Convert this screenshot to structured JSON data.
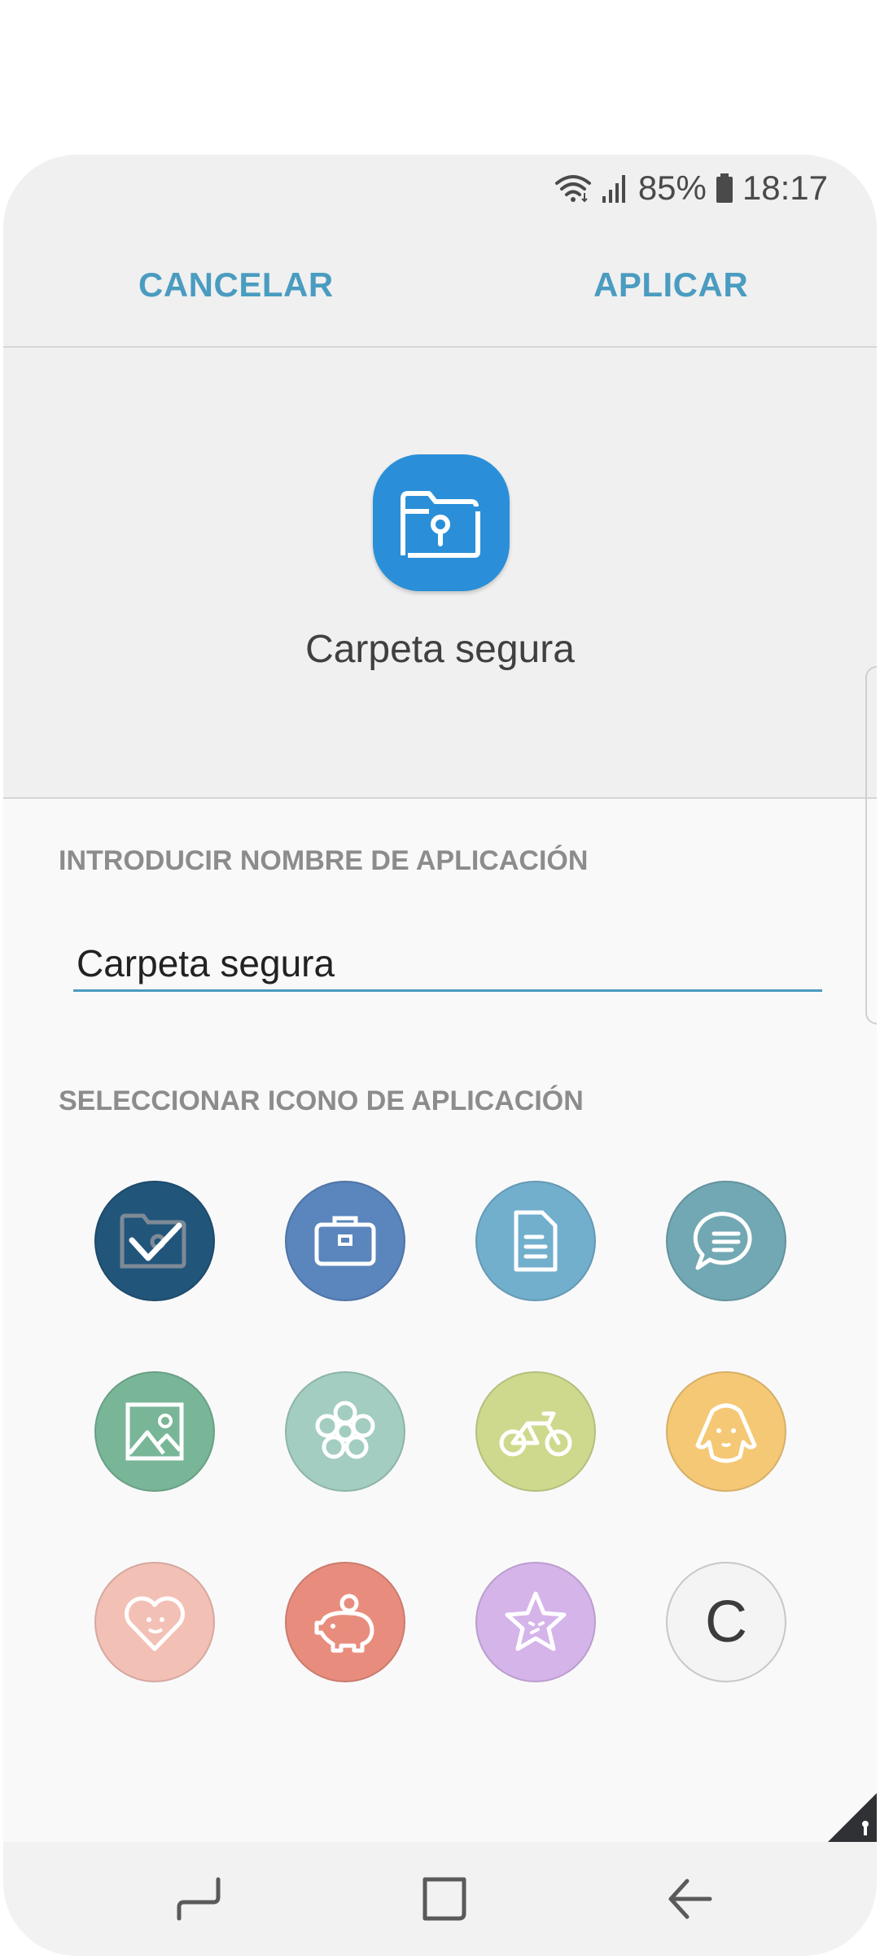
{
  "status_bar": {
    "battery": "85%",
    "time": "18:17"
  },
  "action_bar": {
    "cancel_label": "CANCELAR",
    "apply_label": "APLICAR",
    "accent_color": "#4a9cc0"
  },
  "preview": {
    "app_name": "Carpeta segura",
    "icon": "secure-folder-icon",
    "icon_color": "#2a8fd8"
  },
  "name_section": {
    "label": "INTRODUCIR NOMBRE DE APLICACIÓN",
    "value": "Carpeta segura"
  },
  "icon_section": {
    "label": "SELECCIONAR ICONO DE APLICACIÓN",
    "icons": [
      {
        "name": "secure-folder-icon",
        "color": "#22557a",
        "selected": true
      },
      {
        "name": "briefcase-icon",
        "color": "#5a85bd",
        "selected": false
      },
      {
        "name": "document-icon",
        "color": "#72afcd",
        "selected": false
      },
      {
        "name": "chat-bubble-icon",
        "color": "#72a8b3",
        "selected": false
      },
      {
        "name": "picture-icon",
        "color": "#79b698",
        "selected": false
      },
      {
        "name": "flower-icon",
        "color": "#a3cdc1",
        "selected": false
      },
      {
        "name": "bicycle-icon",
        "color": "#cfd98e",
        "selected": false
      },
      {
        "name": "dog-icon",
        "color": "#f5c876",
        "selected": false
      },
      {
        "name": "heart-face-icon",
        "color": "#f3c0b6",
        "selected": false
      },
      {
        "name": "piggy-bank-icon",
        "color": "#e88d7e",
        "selected": false
      },
      {
        "name": "star-face-icon",
        "color": "#d5b4ea",
        "selected": false
      },
      {
        "name": "letter-icon",
        "color": "#f4f4f4",
        "selected": false,
        "letter": "C"
      }
    ]
  },
  "nav_bar": {
    "buttons": [
      "recents-icon",
      "home-icon",
      "back-icon"
    ]
  }
}
